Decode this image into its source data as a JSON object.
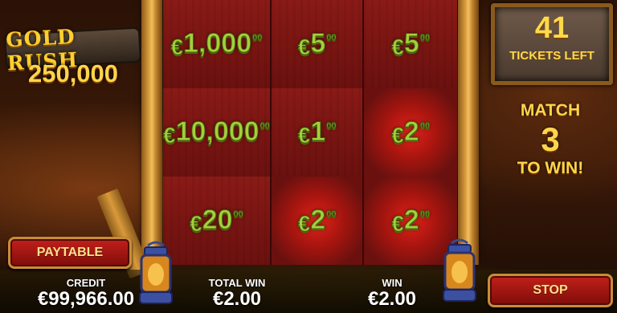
{
  "game": {
    "logo_text": "GOLD RUSH",
    "jackpot": "250,000"
  },
  "grid": {
    "cells": [
      {
        "currency": "€",
        "amount": "1,000",
        "decimals": "00",
        "highlight": false
      },
      {
        "currency": "€",
        "amount": "5",
        "decimals": "00",
        "highlight": false
      },
      {
        "currency": "€",
        "amount": "5",
        "decimals": "00",
        "highlight": false
      },
      {
        "currency": "€",
        "amount": "10,000",
        "decimals": "00",
        "highlight": false
      },
      {
        "currency": "€",
        "amount": "1",
        "decimals": "00",
        "highlight": false
      },
      {
        "currency": "€",
        "amount": "2",
        "decimals": "00",
        "highlight": true
      },
      {
        "currency": "€",
        "amount": "20",
        "decimals": "00",
        "highlight": false
      },
      {
        "currency": "€",
        "amount": "2",
        "decimals": "00",
        "highlight": true
      },
      {
        "currency": "€",
        "amount": "2",
        "decimals": "00",
        "highlight": true
      }
    ]
  },
  "tickets": {
    "count": "41",
    "label": "TICKETS LEFT"
  },
  "match": {
    "line1": "MATCH",
    "line2": "3",
    "line3": "TO WIN!"
  },
  "buttons": {
    "paytable": "PAYTABLE",
    "stop": "STOP"
  },
  "stats": {
    "credit_label": "CREDIT",
    "credit_value": "€99,966.00",
    "total_win_label": "TOTAL WIN",
    "total_win_value": "€2.00",
    "win_label": "WIN",
    "win_value": "€2.00"
  },
  "colors": {
    "prize_green": "#a6cf3a",
    "gold": "#ffd54a",
    "button_red": "#c2201a",
    "cell_red": "#7a1512"
  }
}
